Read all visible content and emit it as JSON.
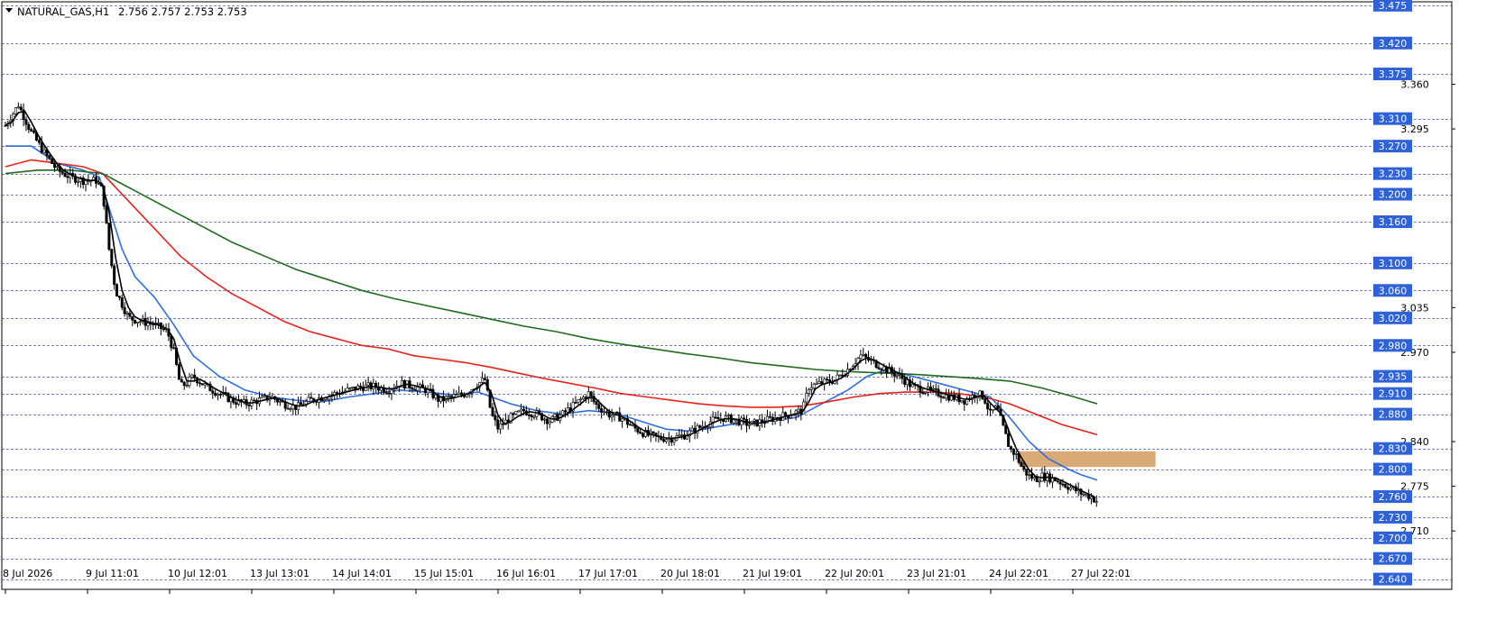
{
  "header": {
    "symbol_label": "NATURAL_GAS,H1",
    "ohlc_text": "2.756 2.757 2.753 2.753",
    "menu_icon": "triangle-down-icon"
  },
  "colors": {
    "background": "#ffffff",
    "grid": "#7a7fbf",
    "frame": "#000000",
    "candle": "#000000",
    "ma_fast": "#000000",
    "ma_medium": "#2e6fe0",
    "ma_slow": "#e8221a",
    "ma_long": "#1e6b1e",
    "price_tag_bg": "#2f62d6",
    "price_tag_text": "#ffffff",
    "zone_fill": "#d9a976"
  },
  "chart_data": {
    "type": "candlestick",
    "instrument": "NATURAL_GAS",
    "timeframe": "H1",
    "last_ohlc": {
      "open": 2.756,
      "high": 2.757,
      "low": 2.753,
      "close": 2.753
    },
    "ylim": [
      2.625,
      3.48
    ],
    "y_ticks": [
      3.36,
      3.295,
      3.035,
      2.97,
      2.84,
      2.775,
      2.71
    ],
    "price_levels": [
      3.475,
      3.42,
      3.375,
      3.31,
      3.27,
      3.23,
      3.2,
      3.16,
      3.1,
      3.06,
      3.02,
      2.98,
      2.935,
      2.91,
      2.88,
      2.83,
      2.8,
      2.76,
      2.73,
      2.7,
      2.67,
      2.64
    ],
    "price_tags": [
      "3.475",
      "3.420",
      "3.375",
      "3.310",
      "3.270",
      "3.230",
      "3.200",
      "3.160",
      "3.100",
      "3.060",
      "3.020",
      "2.980",
      "2.935",
      "2.910",
      "2.880",
      "2.830",
      "2.800",
      "2.760",
      "2.730",
      "2.700",
      "2.670",
      "2.640"
    ],
    "x_labels": [
      "8 Jul 2026",
      "9 Jul 11:01",
      "10 Jul 12:01",
      "13 Jul 13:01",
      "14 Jul 14:01",
      "15 Jul 15:01",
      "16 Jul 16:01",
      "17 Jul 17:01",
      "20 Jul 18:01",
      "21 Jul 19:01",
      "22 Jul 20:01",
      "23 Jul 21:01",
      "24 Jul 22:01",
      "27 Jul 22:01"
    ],
    "close_path": [
      [
        0,
        3.3
      ],
      [
        4,
        3.33
      ],
      [
        8,
        3.29
      ],
      [
        12,
        3.26
      ],
      [
        16,
        3.235
      ],
      [
        20,
        3.225
      ],
      [
        24,
        3.22
      ],
      [
        28,
        3.22
      ],
      [
        30,
        3.205
      ],
      [
        32,
        3.12
      ],
      [
        34,
        3.06
      ],
      [
        36,
        3.04
      ],
      [
        38,
        3.02
      ],
      [
        42,
        3.015
      ],
      [
        46,
        3.01
      ],
      [
        50,
        3.0
      ],
      [
        52,
        2.97
      ],
      [
        54,
        2.92
      ],
      [
        56,
        2.925
      ],
      [
        58,
        2.935
      ],
      [
        62,
        2.92
      ],
      [
        66,
        2.91
      ],
      [
        70,
        2.9
      ],
      [
        74,
        2.895
      ],
      [
        78,
        2.9
      ],
      [
        82,
        2.905
      ],
      [
        86,
        2.895
      ],
      [
        90,
        2.89
      ],
      [
        94,
        2.9
      ],
      [
        98,
        2.905
      ],
      [
        102,
        2.91
      ],
      [
        106,
        2.915
      ],
      [
        110,
        2.92
      ],
      [
        114,
        2.92
      ],
      [
        118,
        2.915
      ],
      [
        122,
        2.925
      ],
      [
        126,
        2.92
      ],
      [
        130,
        2.915
      ],
      [
        134,
        2.9
      ],
      [
        138,
        2.905
      ],
      [
        142,
        2.91
      ],
      [
        146,
        2.925
      ],
      [
        148,
        2.93
      ],
      [
        150,
        2.88
      ],
      [
        152,
        2.86
      ],
      [
        156,
        2.875
      ],
      [
        160,
        2.885
      ],
      [
        164,
        2.88
      ],
      [
        168,
        2.87
      ],
      [
        172,
        2.88
      ],
      [
        176,
        2.895
      ],
      [
        180,
        2.91
      ],
      [
        182,
        2.895
      ],
      [
        186,
        2.88
      ],
      [
        190,
        2.875
      ],
      [
        194,
        2.86
      ],
      [
        198,
        2.85
      ],
      [
        202,
        2.845
      ],
      [
        206,
        2.845
      ],
      [
        210,
        2.85
      ],
      [
        214,
        2.86
      ],
      [
        218,
        2.87
      ],
      [
        222,
        2.875
      ],
      [
        226,
        2.87
      ],
      [
        230,
        2.865
      ],
      [
        234,
        2.87
      ],
      [
        238,
        2.875
      ],
      [
        242,
        2.88
      ],
      [
        246,
        2.885
      ],
      [
        248,
        2.92
      ],
      [
        252,
        2.925
      ],
      [
        256,
        2.93
      ],
      [
        260,
        2.945
      ],
      [
        264,
        2.965
      ],
      [
        268,
        2.955
      ],
      [
        272,
        2.945
      ],
      [
        276,
        2.935
      ],
      [
        280,
        2.92
      ],
      [
        284,
        2.915
      ],
      [
        288,
        2.91
      ],
      [
        292,
        2.905
      ],
      [
        296,
        2.9
      ],
      [
        300,
        2.91
      ],
      [
        302,
        2.905
      ],
      [
        304,
        2.88
      ],
      [
        306,
        2.89
      ],
      [
        308,
        2.86
      ],
      [
        310,
        2.83
      ],
      [
        312,
        2.82
      ],
      [
        314,
        2.8
      ],
      [
        316,
        2.79
      ],
      [
        318,
        2.785
      ],
      [
        320,
        2.79
      ],
      [
        324,
        2.785
      ],
      [
        328,
        2.775
      ],
      [
        332,
        2.765
      ],
      [
        335,
        2.76
      ],
      [
        337,
        2.753
      ]
    ],
    "series": [
      {
        "name": "",
        "color_key": "ma_medium",
        "values": [
          [
            0,
            3.27
          ],
          [
            8,
            3.27
          ],
          [
            16,
            3.245
          ],
          [
            24,
            3.235
          ],
          [
            29,
            3.225
          ],
          [
            32,
            3.18
          ],
          [
            36,
            3.12
          ],
          [
            40,
            3.08
          ],
          [
            46,
            3.05
          ],
          [
            52,
            3.01
          ],
          [
            58,
            2.965
          ],
          [
            66,
            2.935
          ],
          [
            74,
            2.915
          ],
          [
            82,
            2.905
          ],
          [
            90,
            2.9
          ],
          [
            98,
            2.898
          ],
          [
            106,
            2.905
          ],
          [
            114,
            2.91
          ],
          [
            122,
            2.915
          ],
          [
            130,
            2.912
          ],
          [
            138,
            2.908
          ],
          [
            146,
            2.912
          ],
          [
            150,
            2.905
          ],
          [
            156,
            2.895
          ],
          [
            164,
            2.885
          ],
          [
            172,
            2.88
          ],
          [
            180,
            2.885
          ],
          [
            188,
            2.882
          ],
          [
            196,
            2.87
          ],
          [
            204,
            2.858
          ],
          [
            212,
            2.855
          ],
          [
            220,
            2.862
          ],
          [
            228,
            2.868
          ],
          [
            236,
            2.87
          ],
          [
            244,
            2.875
          ],
          [
            252,
            2.895
          ],
          [
            260,
            2.915
          ],
          [
            266,
            2.935
          ],
          [
            272,
            2.945
          ],
          [
            280,
            2.935
          ],
          [
            288,
            2.925
          ],
          [
            296,
            2.915
          ],
          [
            304,
            2.905
          ],
          [
            310,
            2.875
          ],
          [
            316,
            2.84
          ],
          [
            322,
            2.815
          ],
          [
            328,
            2.8
          ],
          [
            332,
            2.792
          ],
          [
            337,
            2.784
          ]
        ]
      },
      {
        "name": "",
        "color_key": "ma_slow",
        "values": [
          [
            0,
            3.24
          ],
          [
            8,
            3.25
          ],
          [
            16,
            3.245
          ],
          [
            24,
            3.24
          ],
          [
            30,
            3.23
          ],
          [
            38,
            3.19
          ],
          [
            46,
            3.15
          ],
          [
            54,
            3.11
          ],
          [
            62,
            3.08
          ],
          [
            70,
            3.055
          ],
          [
            78,
            3.035
          ],
          [
            86,
            3.015
          ],
          [
            94,
            3.0
          ],
          [
            102,
            2.99
          ],
          [
            110,
            2.98
          ],
          [
            118,
            2.975
          ],
          [
            126,
            2.965
          ],
          [
            134,
            2.96
          ],
          [
            142,
            2.955
          ],
          [
            150,
            2.948
          ],
          [
            158,
            2.94
          ],
          [
            166,
            2.932
          ],
          [
            174,
            2.925
          ],
          [
            182,
            2.918
          ],
          [
            190,
            2.91
          ],
          [
            198,
            2.905
          ],
          [
            206,
            2.9
          ],
          [
            214,
            2.895
          ],
          [
            222,
            2.892
          ],
          [
            230,
            2.89
          ],
          [
            238,
            2.89
          ],
          [
            246,
            2.892
          ],
          [
            254,
            2.898
          ],
          [
            262,
            2.905
          ],
          [
            270,
            2.91
          ],
          [
            278,
            2.912
          ],
          [
            286,
            2.912
          ],
          [
            294,
            2.91
          ],
          [
            302,
            2.905
          ],
          [
            310,
            2.895
          ],
          [
            318,
            2.88
          ],
          [
            326,
            2.865
          ],
          [
            337,
            2.85
          ]
        ]
      },
      {
        "name": "",
        "color_key": "ma_long",
        "values": [
          [
            0,
            3.23
          ],
          [
            10,
            3.235
          ],
          [
            20,
            3.235
          ],
          [
            30,
            3.23
          ],
          [
            40,
            3.205
          ],
          [
            50,
            3.18
          ],
          [
            60,
            3.155
          ],
          [
            70,
            3.13
          ],
          [
            80,
            3.11
          ],
          [
            90,
            3.09
          ],
          [
            100,
            3.075
          ],
          [
            110,
            3.06
          ],
          [
            120,
            3.048
          ],
          [
            130,
            3.038
          ],
          [
            140,
            3.028
          ],
          [
            150,
            3.018
          ],
          [
            160,
            3.008
          ],
          [
            170,
            3.0
          ],
          [
            180,
            2.99
          ],
          [
            190,
            2.982
          ],
          [
            200,
            2.975
          ],
          [
            210,
            2.968
          ],
          [
            220,
            2.962
          ],
          [
            230,
            2.955
          ],
          [
            240,
            2.95
          ],
          [
            250,
            2.945
          ],
          [
            260,
            2.942
          ],
          [
            270,
            2.94
          ],
          [
            280,
            2.938
          ],
          [
            290,
            2.935
          ],
          [
            300,
            2.932
          ],
          [
            310,
            2.928
          ],
          [
            320,
            2.918
          ],
          [
            330,
            2.905
          ],
          [
            337,
            2.895
          ]
        ]
      }
    ],
    "zones": [
      {
        "x0": 313,
        "x1": 355,
        "y0": 2.803,
        "y1": 2.826
      }
    ],
    "x_count": 420
  }
}
